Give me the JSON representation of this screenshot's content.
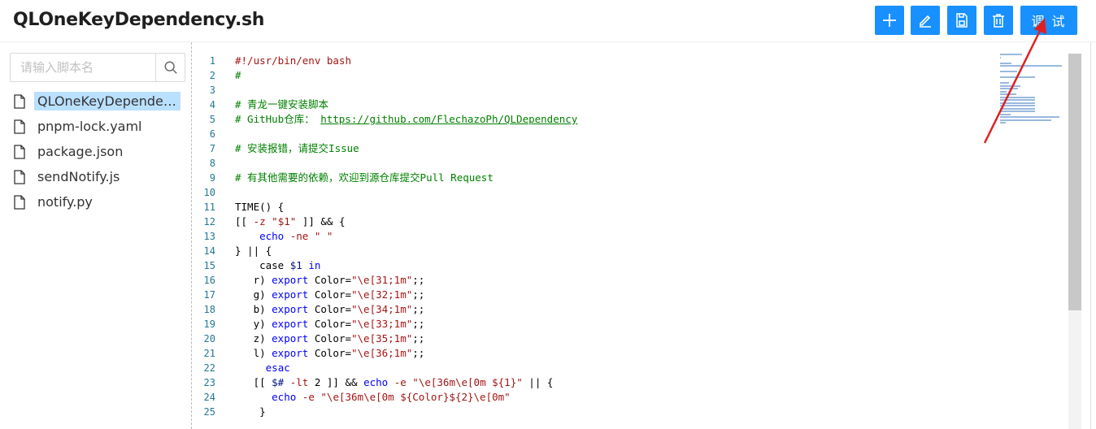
{
  "header": {
    "title": "QLOneKeyDependency.sh",
    "debug_label": "调 试",
    "accent": "#1890ff"
  },
  "toolbar": {
    "icons": [
      "plus-icon",
      "edit-icon",
      "save-icon",
      "delete-icon"
    ]
  },
  "search": {
    "placeholder": "请输入脚本名",
    "icon": "search-icon"
  },
  "files": [
    {
      "name": "QLOneKeyDependency.sh",
      "active": true
    },
    {
      "name": "pnpm-lock.yaml",
      "active": false
    },
    {
      "name": "package.json",
      "active": false
    },
    {
      "name": "sendNotify.js",
      "active": false
    },
    {
      "name": "notify.py",
      "active": false
    }
  ],
  "editor": {
    "line_numbers": [
      "1",
      "2",
      "3",
      "4",
      "5",
      "6",
      "7",
      "8",
      "9",
      "10",
      "11",
      "12",
      "13",
      "14",
      "15",
      "16",
      "17",
      "18",
      "19",
      "20",
      "21",
      "22",
      "23",
      "24",
      "25"
    ],
    "lines": [
      [
        {
          "t": "#!/usr/bin/env bash",
          "c": "c-str"
        }
      ],
      [
        {
          "t": "#",
          "c": "c-cm"
        }
      ],
      [
        {
          "t": "",
          "c": ""
        }
      ],
      [
        {
          "t": "# 青龙一键安装脚本",
          "c": "c-cm"
        }
      ],
      [
        {
          "t": "# GitHub仓库： ",
          "c": "c-cm"
        },
        {
          "t": "https://github.com/FlechazoPh/QLDependency",
          "c": "c-url"
        }
      ],
      [
        {
          "t": "",
          "c": ""
        }
      ],
      [
        {
          "t": "# 安装报错，请提交Issue",
          "c": "c-cm"
        }
      ],
      [
        {
          "t": "",
          "c": ""
        }
      ],
      [
        {
          "t": "# 有其他需要的依赖，欢迎到源仓库提交Pull Request",
          "c": "c-cm"
        }
      ],
      [
        {
          "t": "",
          "c": ""
        }
      ],
      [
        {
          "t": "TIME() {",
          "c": ""
        }
      ],
      [
        {
          "t": "[[ ",
          "c": ""
        },
        {
          "t": "-z",
          "c": "c-op"
        },
        {
          "t": " ",
          "c": ""
        },
        {
          "t": "\"$1\"",
          "c": "c-str"
        },
        {
          "t": " ]] && {",
          "c": ""
        }
      ],
      [
        {
          "t": "    ",
          "c": ""
        },
        {
          "t": "echo",
          "c": "c-kw"
        },
        {
          "t": " ",
          "c": ""
        },
        {
          "t": "-ne",
          "c": "c-op"
        },
        {
          "t": " ",
          "c": ""
        },
        {
          "t": "\" \"",
          "c": "c-str"
        }
      ],
      [
        {
          "t": "} || {",
          "c": ""
        }
      ],
      [
        {
          "t": "    case ",
          "c": ""
        },
        {
          "t": "$1",
          "c": "c-var"
        },
        {
          "t": " ",
          "c": ""
        },
        {
          "t": "in",
          "c": "c-kw"
        }
      ],
      [
        {
          "t": "   r) ",
          "c": ""
        },
        {
          "t": "export",
          "c": "c-kw"
        },
        {
          "t": " Color=",
          "c": ""
        },
        {
          "t": "\"\\e[31;1m\"",
          "c": "c-str"
        },
        {
          "t": ";;",
          "c": ""
        }
      ],
      [
        {
          "t": "   g) ",
          "c": ""
        },
        {
          "t": "export",
          "c": "c-kw"
        },
        {
          "t": " Color=",
          "c": ""
        },
        {
          "t": "\"\\e[32;1m\"",
          "c": "c-str"
        },
        {
          "t": ";;",
          "c": ""
        }
      ],
      [
        {
          "t": "   b) ",
          "c": ""
        },
        {
          "t": "export",
          "c": "c-kw"
        },
        {
          "t": " Color=",
          "c": ""
        },
        {
          "t": "\"\\e[34;1m\"",
          "c": "c-str"
        },
        {
          "t": ";;",
          "c": ""
        }
      ],
      [
        {
          "t": "   y) ",
          "c": ""
        },
        {
          "t": "export",
          "c": "c-kw"
        },
        {
          "t": " Color=",
          "c": ""
        },
        {
          "t": "\"\\e[33;1m\"",
          "c": "c-str"
        },
        {
          "t": ";;",
          "c": ""
        }
      ],
      [
        {
          "t": "   z) ",
          "c": ""
        },
        {
          "t": "export",
          "c": "c-kw"
        },
        {
          "t": " Color=",
          "c": ""
        },
        {
          "t": "\"\\e[35;1m\"",
          "c": "c-str"
        },
        {
          "t": ";;",
          "c": ""
        }
      ],
      [
        {
          "t": "   l) ",
          "c": ""
        },
        {
          "t": "export",
          "c": "c-kw"
        },
        {
          "t": " Color=",
          "c": ""
        },
        {
          "t": "\"\\e[36;1m\"",
          "c": "c-str"
        },
        {
          "t": ";;",
          "c": ""
        }
      ],
      [
        {
          "t": "     ",
          "c": ""
        },
        {
          "t": "esac",
          "c": "c-kw"
        }
      ],
      [
        {
          "t": "   [[ ",
          "c": ""
        },
        {
          "t": "$#",
          "c": "c-var"
        },
        {
          "t": " ",
          "c": ""
        },
        {
          "t": "-lt",
          "c": "c-op"
        },
        {
          "t": " 2 ]] && ",
          "c": ""
        },
        {
          "t": "echo",
          "c": "c-kw"
        },
        {
          "t": " ",
          "c": ""
        },
        {
          "t": "-e",
          "c": "c-op"
        },
        {
          "t": " ",
          "c": ""
        },
        {
          "t": "\"\\e[36m\\e[0m ${1}\"",
          "c": "c-str"
        },
        {
          "t": " || {",
          "c": ""
        }
      ],
      [
        {
          "t": "      ",
          "c": ""
        },
        {
          "t": "echo",
          "c": "c-kw"
        },
        {
          "t": " ",
          "c": ""
        },
        {
          "t": "-e",
          "c": "c-op"
        },
        {
          "t": " ",
          "c": ""
        },
        {
          "t": "\"\\e[36m\\e[0m ${Color}${2}\\e[0m\"",
          "c": "c-str"
        }
      ],
      [
        {
          "t": "    }",
          "c": ""
        }
      ]
    ]
  }
}
